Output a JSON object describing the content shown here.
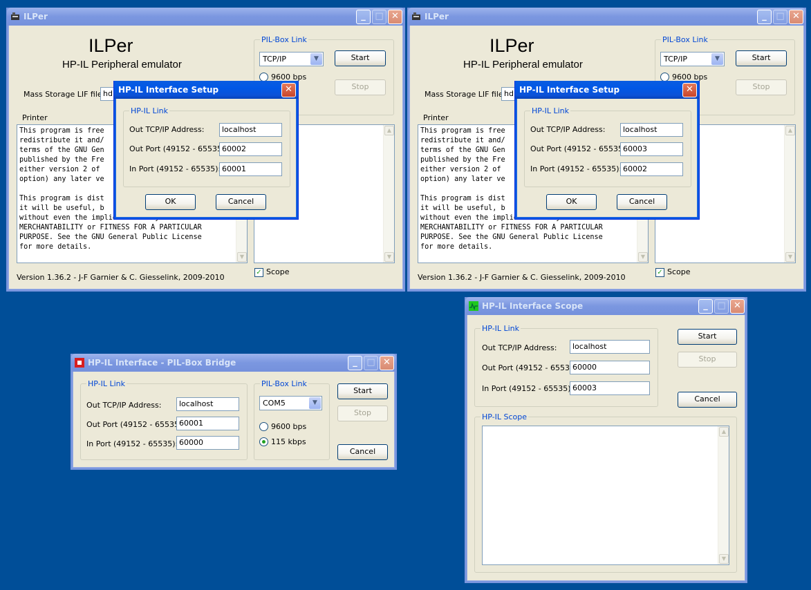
{
  "ilper1": {
    "title": "ILPer",
    "app_title": "ILPer",
    "subtitle": "HP-IL Peripheral emulator",
    "pilbox_group": "PIL-Box Link",
    "protocol": "TCP/IP",
    "radio_9600": "9600 bps",
    "start": "Start",
    "stop": "Stop",
    "mass_storage_label": "Mass Storage LIF file",
    "mass_storage_value": "hdr",
    "printer_group": "Printer",
    "printer_text": "This program is free\nredistribute it and/\nterms of the GNU Gen\npublished by the Fre\neither version 2 of\noption) any later ve\n\nThis program is dist\nit will be useful, b\nwithout even the implied warranty of\nMERCHANTABILITY or FITNESS FOR A PARTICULAR\nPURPOSE. See the GNU General Public License\nfor more details.",
    "scope_label": "Scope",
    "version": "Version 1.36.2  -  J-F Garnier & C. Giesselink, 2009-2010"
  },
  "setup1": {
    "title": "HP-IL Interface Setup",
    "group": "HP-IL Link",
    "addr_label": "Out TCP/IP Address:",
    "addr_value": "localhost",
    "out_label": "Out Port (49152 - 65535):",
    "out_value": "60002",
    "in_label": "In Port (49152 - 65535):",
    "in_value": "60001",
    "ok": "OK",
    "cancel": "Cancel"
  },
  "ilper2": {
    "title": "ILPer",
    "app_title": "ILPer",
    "subtitle": "HP-IL Peripheral emulator",
    "pilbox_group": "PIL-Box Link",
    "protocol": "TCP/IP",
    "radio_9600": "9600 bps",
    "start": "Start",
    "stop": "Stop",
    "mass_storage_label": "Mass Storage LIF file",
    "mass_storage_value": "hdr",
    "printer_group": "Printer",
    "printer_text": "This program is free\nredistribute it and/\nterms of the GNU Gen\npublished by the Fre\neither version 2 of\noption) any later ve\n\nThis program is dist\nit will be useful, b\nwithout even the implied warranty of\nMERCHANTABILITY or FITNESS FOR A PARTICULAR\nPURPOSE. See the GNU General Public License\nfor more details.",
    "scope_label": "Scope",
    "version": "Version 1.36.2  -  J-F Garnier & C. Giesselink, 2009-2010"
  },
  "setup2": {
    "title": "HP-IL Interface Setup",
    "group": "HP-IL Link",
    "addr_label": "Out TCP/IP Address:",
    "addr_value": "localhost",
    "out_label": "Out Port (49152 - 65535):",
    "out_value": "60003",
    "in_label": "In Port (49152 - 65535):",
    "in_value": "60002",
    "ok": "OK",
    "cancel": "Cancel"
  },
  "bridge": {
    "title": "HP-IL Interface - PIL-Box Bridge",
    "hpil_group": "HP-IL Link",
    "addr_label": "Out TCP/IP Address:",
    "addr_value": "localhost",
    "out_label": "Out Port (49152 - 65535):",
    "out_value": "60001",
    "in_label": "In Port (49152 - 65535):",
    "in_value": "60000",
    "pilbox_group": "PIL-Box Link",
    "com_port": "COM5",
    "radio_9600": "9600 bps",
    "radio_115": "115 kbps",
    "start": "Start",
    "stop": "Stop",
    "cancel": "Cancel"
  },
  "scope": {
    "title": "HP-IL Interface Scope",
    "hpil_group": "HP-IL Link",
    "addr_label": "Out TCP/IP Address:",
    "addr_value": "localhost",
    "out_label": "Out Port (49152 - 65535):",
    "out_value": "60000",
    "in_label": "In Port (49152 - 65535):",
    "in_value": "60003",
    "start": "Start",
    "stop": "Stop",
    "cancel": "Cancel",
    "scope_group": "HP-IL Scope"
  },
  "colors": {
    "desktop": "#004e98",
    "titlebar_active": "#0058e6",
    "group_title": "#0046d5"
  }
}
